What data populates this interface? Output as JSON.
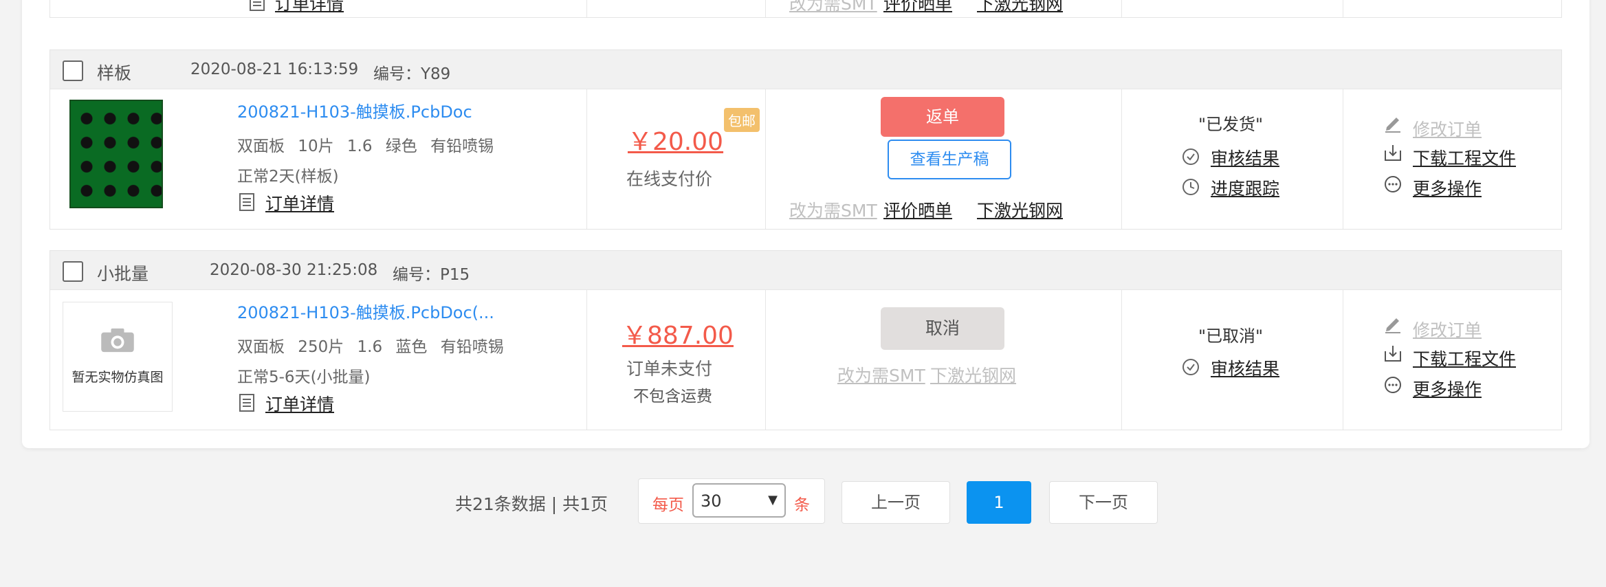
{
  "partial_order_top": {
    "detail_link": "订单详情",
    "links": [
      "改为需SMT",
      "评价晒单",
      "下激光钢网"
    ]
  },
  "orders": [
    {
      "type": "样板",
      "time": "2020-08-21 16:13:59",
      "code": "编号：Y89",
      "file_name": "200821-H103-触摸板.PcbDoc",
      "spec": "双面板 10片 1.6 绿色 有铅喷锡",
      "lead_time": "正常2天(样板)",
      "detail_link": "订单详情",
      "price": "￥20.00",
      "price_note": "在线支付价",
      "badge": "包邮",
      "primary_btn": "返单",
      "secondary_btn": "查看生产稿",
      "links": [
        "改为需SMT",
        "评价晒单",
        "下激光钢网"
      ],
      "status": "\"已发货\"",
      "status_links": [
        "审核结果",
        "进度跟踪"
      ],
      "ops": [
        "修改订单",
        "下载工程文件",
        "更多操作"
      ]
    },
    {
      "type": "小批量",
      "time": "2020-08-30 21:25:08",
      "code": "编号：P15",
      "no_photo": "暂无实物仿真图",
      "file_name": "200821-H103-触摸板.PcbDoc(...",
      "spec": "双面板 250片 1.6 蓝色 有铅喷锡",
      "lead_time": "正常5-6天(小批量)",
      "detail_link": "订单详情",
      "price": "￥887.00",
      "price_note": "订单未支付",
      "price_note2": "不包含运费",
      "primary_btn": "取消",
      "links": [
        "改为需SMT",
        "下激光钢网"
      ],
      "status": "\"已取消\"",
      "status_links": [
        "审核结果"
      ],
      "ops": [
        "修改订单",
        "下载工程文件",
        "更多操作"
      ]
    }
  ],
  "pagination": {
    "summary": "共21条数据 | 共1页",
    "per_page_label": "每页",
    "per_page_value": "30",
    "per_page_unit": "条",
    "prev": "上一页",
    "current": "1",
    "next": "下一页"
  },
  "colors": {
    "accent": "#2d8cf0",
    "price": "#f35a4a",
    "return_btn": "#f4706b",
    "current_page": "#0b93f0"
  }
}
